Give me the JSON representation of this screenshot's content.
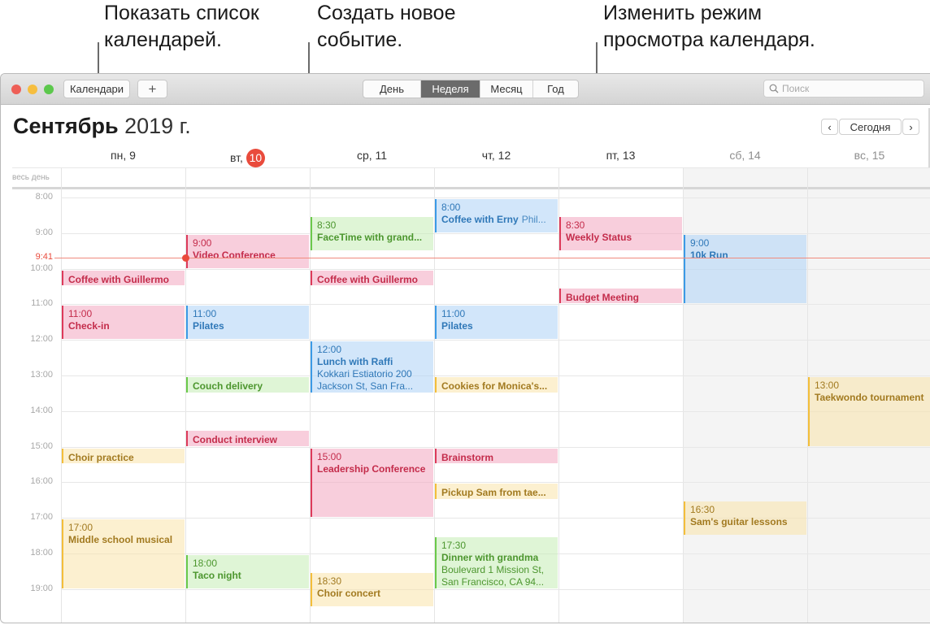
{
  "callouts": [
    {
      "id": "calendars",
      "text": "Показать список\nкалендарей."
    },
    {
      "id": "new_event",
      "text": "Создать новое\nсобытие."
    },
    {
      "id": "view_mode",
      "text": "Изменить режим\nпросмотра календаря."
    }
  ],
  "toolbar": {
    "calendars_label": "Календари",
    "add_label": "+",
    "views": [
      {
        "label": "День",
        "active": false
      },
      {
        "label": "Неделя",
        "active": true
      },
      {
        "label": "Месяц",
        "active": false
      },
      {
        "label": "Год",
        "active": false
      }
    ],
    "search_placeholder": "Поиск",
    "search_icon": "magnifier-icon"
  },
  "header": {
    "month": "Сентябрь",
    "year": "2019 г.",
    "prev_icon": "‹",
    "today_label": "Сегодня",
    "next_icon": "›"
  },
  "days": [
    {
      "label": "пн, 9",
      "weekend": false,
      "today": false
    },
    {
      "label": "вт,",
      "num": "10",
      "weekend": false,
      "today": true
    },
    {
      "label": "ср, 11",
      "weekend": false,
      "today": false
    },
    {
      "label": "чт, 12",
      "weekend": false,
      "today": false
    },
    {
      "label": "пт, 13",
      "weekend": false,
      "today": false
    },
    {
      "label": "сб, 14",
      "weekend": true,
      "today": false
    },
    {
      "label": "вс, 15",
      "weekend": true,
      "today": false
    }
  ],
  "allday_label": "весь день",
  "hours": [
    "8:00",
    "9:00",
    "10:00",
    "11:00",
    "12:00",
    "13:00",
    "14:00",
    "15:00",
    "16:00",
    "17:00",
    "18:00",
    "19:00"
  ],
  "now": {
    "label": "9:41",
    "time": 9.683,
    "day": 1
  },
  "colors": {
    "red": "#dd3a5a",
    "blue": "#3b9ae6",
    "green": "#6ac94a",
    "yellow": "#f3be3a",
    "today": "#e94b3c"
  },
  "events": [
    {
      "day": 0,
      "start": 10.0,
      "end": 10.5,
      "color": "red",
      "title": "Coffee with Guillermo"
    },
    {
      "day": 0,
      "start": 11.0,
      "end": 12.0,
      "color": "red",
      "time": "11:00",
      "title": "Check-in"
    },
    {
      "day": 0,
      "start": 15.0,
      "end": 15.5,
      "color": "yellow",
      "title": "Choir practice"
    },
    {
      "day": 0,
      "start": 17.0,
      "end": 19.0,
      "color": "yellow",
      "time": "17:00",
      "title": "Middle school musical"
    },
    {
      "day": 1,
      "start": 9.0,
      "end": 10.0,
      "color": "red",
      "time": "9:00",
      "title": "Video Conference"
    },
    {
      "day": 1,
      "start": 11.0,
      "end": 12.0,
      "color": "blue",
      "time": "11:00",
      "title": "Pilates"
    },
    {
      "day": 1,
      "start": 13.0,
      "end": 13.5,
      "color": "green",
      "title": "Couch delivery"
    },
    {
      "day": 1,
      "start": 14.5,
      "end": 15.0,
      "color": "red",
      "title": "Conduct interview"
    },
    {
      "day": 1,
      "start": 18.0,
      "end": 19.0,
      "color": "green",
      "time": "18:00",
      "title": "Taco night"
    },
    {
      "day": 2,
      "start": 8.5,
      "end": 9.5,
      "color": "green",
      "time": "8:30",
      "title": "FaceTime with grand..."
    },
    {
      "day": 2,
      "start": 10.0,
      "end": 10.5,
      "color": "red",
      "title": "Coffee with Guillermo"
    },
    {
      "day": 2,
      "start": 12.0,
      "end": 13.5,
      "color": "blue",
      "time": "12:00",
      "title": "Lunch with Raffi",
      "detail": "Kokkari Estiatorio 200 Jackson St, San Fra..."
    },
    {
      "day": 2,
      "start": 15.0,
      "end": 17.0,
      "color": "red",
      "time": "15:00",
      "title": "Leadership Conference",
      "wrap": true
    },
    {
      "day": 2,
      "start": 18.5,
      "end": 19.5,
      "color": "yellow",
      "time": "18:30",
      "title": "Choir concert"
    },
    {
      "day": 3,
      "start": 8.0,
      "end": 9.0,
      "color": "blue",
      "time": "8:00",
      "title": "Coffee with Erny",
      "inline": "Phil..."
    },
    {
      "day": 3,
      "start": 11.0,
      "end": 12.0,
      "color": "blue",
      "time": "11:00",
      "title": "Pilates"
    },
    {
      "day": 3,
      "start": 13.0,
      "end": 13.5,
      "color": "yellow",
      "title": "Cookies for Monica's..."
    },
    {
      "day": 3,
      "start": 15.0,
      "end": 15.5,
      "color": "red",
      "title": "Brainstorm"
    },
    {
      "day": 3,
      "start": 16.0,
      "end": 16.5,
      "color": "yellow",
      "title": "Pickup Sam from tae..."
    },
    {
      "day": 3,
      "start": 17.5,
      "end": 19.0,
      "color": "green",
      "time": "17:30",
      "title": "Dinner with grandma",
      "detail": "Boulevard 1 Mission St, San Francisco, CA  94..."
    },
    {
      "day": 4,
      "start": 8.5,
      "end": 9.5,
      "color": "red",
      "time": "8:30",
      "title": "Weekly Status"
    },
    {
      "day": 4,
      "start": 10.5,
      "end": 11.0,
      "color": "red",
      "title": "Budget Meeting"
    },
    {
      "day": 5,
      "start": 9.0,
      "end": 11.0,
      "color": "blue",
      "time": "9:00",
      "title": "10k Run"
    },
    {
      "day": 5,
      "start": 16.5,
      "end": 17.5,
      "color": "yellow",
      "time": "16:30",
      "title": "Sam's guitar lessons"
    },
    {
      "day": 6,
      "start": 13.0,
      "end": 15.0,
      "color": "yellow",
      "time": "13:00",
      "title": "Taekwondo tournament",
      "wrap": true
    }
  ]
}
